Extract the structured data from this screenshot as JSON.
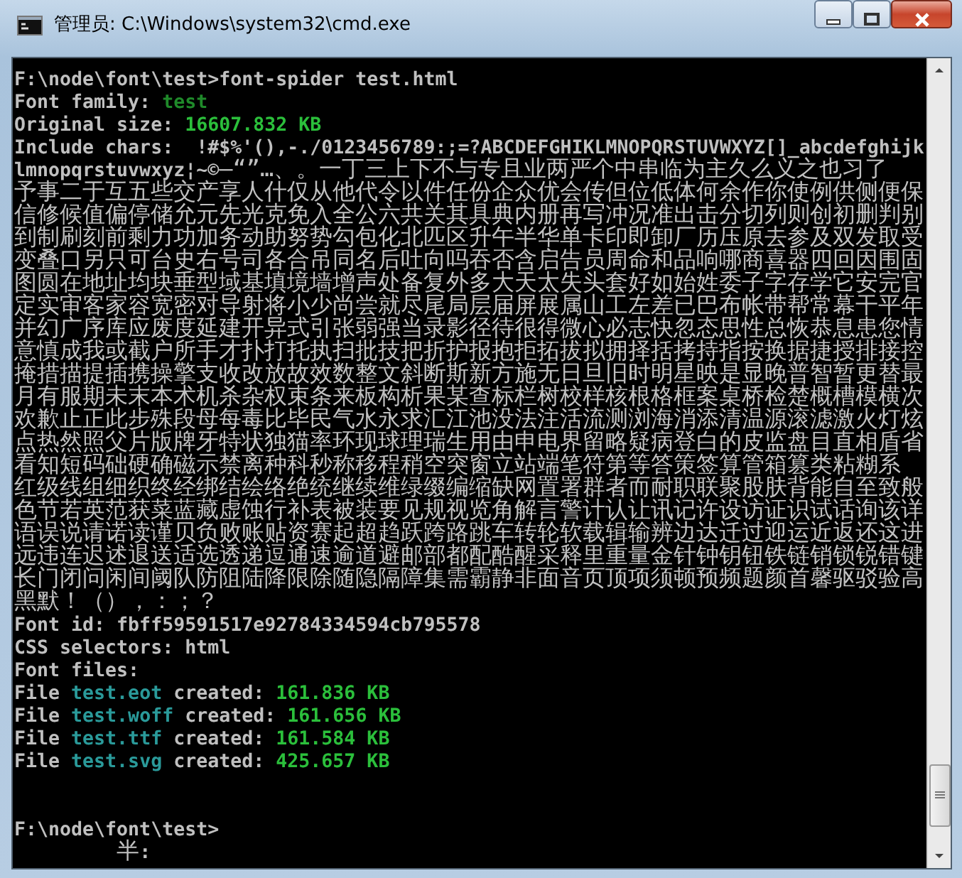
{
  "window": {
    "title": "管理员: C:\\Windows\\system32\\cmd.exe"
  },
  "console": {
    "lines": [
      {
        "segments": [
          {
            "text": "F:\\node\\font\\test>font-spider test.html",
            "color": "#c0c0c0"
          }
        ]
      },
      {
        "segments": [
          {
            "text": "Font family: ",
            "color": "#c0c0c0"
          },
          {
            "text": "test",
            "color": "#1f8a2a"
          }
        ]
      },
      {
        "segments": [
          {
            "text": "Original size: ",
            "color": "#c0c0c0"
          },
          {
            "text": "16607.832 KB",
            "color": "#2bbf3b"
          }
        ]
      },
      {
        "segments": [
          {
            "text": "Include chars:  !#$%'(),-./0123456789:;=?ABCDEFGHIKLMNOPQRSTUVWXYZ[]_abcdefghijk",
            "color": "#c0c0c0"
          }
        ]
      },
      {
        "segments": [
          {
            "text": "lmnopqrstuvwxyz¦~©—“”…、。一丁三上下不与专且业两严个中串临为主久么义之也习了",
            "color": "#c0c0c0"
          }
        ]
      },
      {
        "segments": [
          {
            "text": "予事二于互五些交产享人什仅从他代令以件任份企众优会传但位低体何余作你使例供侧便保",
            "color": "#c0c0c0"
          }
        ]
      },
      {
        "segments": [
          {
            "text": "信修候值偏停储允元先光克免入全公六共关其具典内册再写冲况准出击分切列则创初删判别",
            "color": "#c0c0c0"
          }
        ]
      },
      {
        "segments": [
          {
            "text": "到制刷刻前剩力功加务动助努势勾包化北匹区升午半华单卡印即卸厂历压原去参及双发取受",
            "color": "#c0c0c0"
          }
        ]
      },
      {
        "segments": [
          {
            "text": "变叠口另只可台史右号司各合吊同名后吐向吗吞否含启告员周命和品响哪商喜器四回因围固",
            "color": "#c0c0c0"
          }
        ]
      },
      {
        "segments": [
          {
            "text": "图圆在地址均块垂型域基填境墙增声处备复外多大天太失头套好如始姓委子字存学它安完官",
            "color": "#c0c0c0"
          }
        ]
      },
      {
        "segments": [
          {
            "text": "定实审客家容宽密对导射将小少尚尝就尽尾局层届屏展属山工左差已巴布帐带帮常幕干平年",
            "color": "#c0c0c0"
          }
        ]
      },
      {
        "segments": [
          {
            "text": "并幻广序库应废度延建开异式引张弱强当录影径待很得微心必志快忽态思性总恢恭息患您情",
            "color": "#c0c0c0"
          }
        ]
      },
      {
        "segments": [
          {
            "text": "意慎成我或截户所手才扑打托执扫批技把折护报抱拒拓拔拟拥择括拷持指按换据捷授排接控",
            "color": "#c0c0c0"
          }
        ]
      },
      {
        "segments": [
          {
            "text": "掩措描提插携操擎支收改放故效数整文斜断斯新方施无日旦旧时明星映是显晚普智暂更替最",
            "color": "#c0c0c0"
          }
        ]
      },
      {
        "segments": [
          {
            "text": "月有服期未末本术机杀杂权束条来板构析果某查标栏树校样核根格框案桌桥检楚概槽模横次",
            "color": "#c0c0c0"
          }
        ]
      },
      {
        "segments": [
          {
            "text": "欢歉止正此步殊段母每毒比毕民气水永求汇江池没法注活流测浏海消添清温源滚滤激火灯炫",
            "color": "#c0c0c0"
          }
        ]
      },
      {
        "segments": [
          {
            "text": "点热然照父片版牌牙特状独猫率环现球理瑞生用由申电界留略疑病登白的皮监盘目直相盾省",
            "color": "#c0c0c0"
          }
        ]
      },
      {
        "segments": [
          {
            "text": "看知短码础硬确磁示禁离种科秒称移程稍空突窗立站端笔符第等答策签算管箱篡类粘糊系",
            "color": "#c0c0c0"
          }
        ]
      },
      {
        "segments": [
          {
            "text": "红级线组细织终经绑结绘络绝统继续维绿缀编缩缺网置署群者而耐职联聚股肤背能自至致般",
            "color": "#c0c0c0"
          }
        ]
      },
      {
        "segments": [
          {
            "text": "色节若英范获菜蓝藏虚蚀行补表被装要见规视览角解言警计认让讯记许设访证识试话询该详",
            "color": "#c0c0c0"
          }
        ]
      },
      {
        "segments": [
          {
            "text": "语误说请诺读谨贝负败账贴资赛起超趋跃跨路跳车转轮软载辑输辨边达迁过迎运近返还这进",
            "color": "#c0c0c0"
          }
        ]
      },
      {
        "segments": [
          {
            "text": "远违连迟述退送适选透递逗通速逾道避邮部都配酷醒采释里重量金针钟钥钮铁链销锁锐错键",
            "color": "#c0c0c0"
          }
        ]
      },
      {
        "segments": [
          {
            "text": "长门闭问闲间阈队防阻陆降限除随隐隔障集需霸静非面音页顶项须顿预频题颜首馨驱驳验高",
            "color": "#c0c0c0"
          }
        ]
      },
      {
        "segments": [
          {
            "text": "黑默！（），：；？",
            "color": "#c0c0c0"
          }
        ]
      },
      {
        "segments": [
          {
            "text": "Font id: fbff59591517e92784334594cb795578",
            "color": "#c0c0c0"
          }
        ]
      },
      {
        "segments": [
          {
            "text": "CSS selectors: html",
            "color": "#c0c0c0"
          }
        ]
      },
      {
        "segments": [
          {
            "text": "Font files:",
            "color": "#c0c0c0"
          }
        ]
      },
      {
        "segments": [
          {
            "text": "File ",
            "color": "#c0c0c0"
          },
          {
            "text": "test.eot",
            "color": "#2a9a9a"
          },
          {
            "text": " created: ",
            "color": "#c0c0c0"
          },
          {
            "text": "161.836 KB",
            "color": "#2bbf3b"
          }
        ]
      },
      {
        "segments": [
          {
            "text": "File ",
            "color": "#c0c0c0"
          },
          {
            "text": "test.woff",
            "color": "#2a9a9a"
          },
          {
            "text": " created: ",
            "color": "#c0c0c0"
          },
          {
            "text": "161.656 KB",
            "color": "#2bbf3b"
          }
        ]
      },
      {
        "segments": [
          {
            "text": "File ",
            "color": "#c0c0c0"
          },
          {
            "text": "test.ttf",
            "color": "#2a9a9a"
          },
          {
            "text": " created: ",
            "color": "#c0c0c0"
          },
          {
            "text": "161.584 KB",
            "color": "#2bbf3b"
          }
        ]
      },
      {
        "segments": [
          {
            "text": "File ",
            "color": "#c0c0c0"
          },
          {
            "text": "test.svg",
            "color": "#2a9a9a"
          },
          {
            "text": " created: ",
            "color": "#c0c0c0"
          },
          {
            "text": "425.657 KB",
            "color": "#2bbf3b"
          }
        ]
      },
      {
        "segments": [
          {
            "text": "\n\nF:\\node\\font\\test>",
            "color": "#c0c0c0"
          }
        ]
      },
      {
        "segments": [
          {
            "text": "         半:",
            "color": "#c0c0c0"
          }
        ]
      }
    ]
  }
}
